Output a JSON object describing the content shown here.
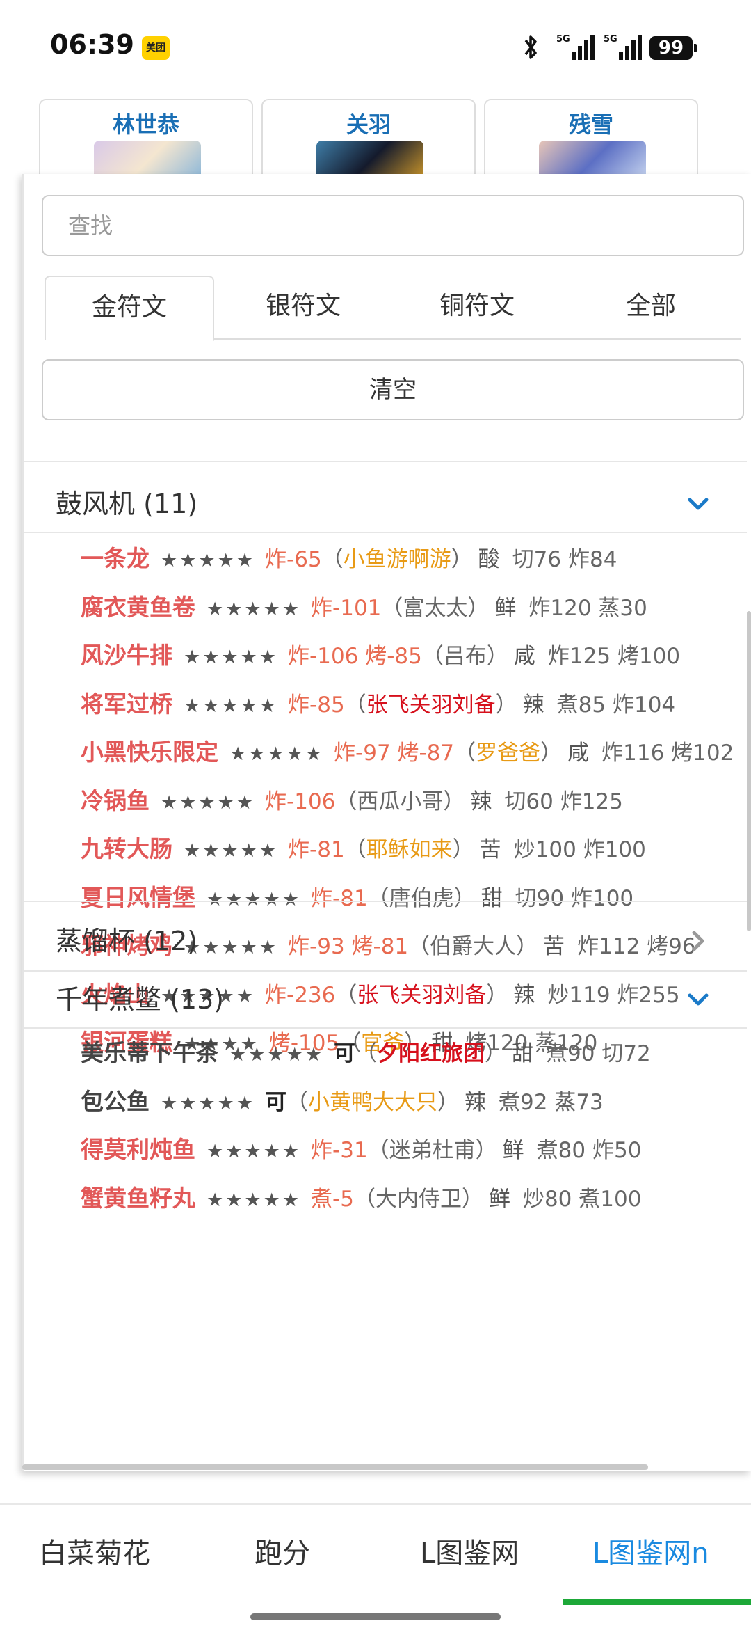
{
  "status_bar": {
    "time": "06:39",
    "app_badge": "美团",
    "battery": "99"
  },
  "cards": [
    {
      "name": "林世恭"
    },
    {
      "name": "关羽"
    },
    {
      "name": "残雪"
    }
  ],
  "search": {
    "placeholder": "查找"
  },
  "tabs": [
    {
      "label": "金符文",
      "active": true
    },
    {
      "label": "银符文",
      "active": false
    },
    {
      "label": "铜符文",
      "active": false
    },
    {
      "label": "全部",
      "active": false
    }
  ],
  "clear_label": "清空",
  "groups": [
    {
      "title": "鼓风机 (11)",
      "expanded": true,
      "dishes": [
        {
          "name": "一条龙",
          "stars": "★★★★★",
          "op": "炸-65",
          "chef": "小鱼游啊游",
          "chef_style": "orange",
          "flavor": "酸",
          "req": "切76 炸84"
        },
        {
          "name": "腐衣黄鱼卷",
          "stars": "★★★★★",
          "op": "炸-101",
          "chef": "富太太",
          "chef_style": "plain",
          "flavor": "鲜",
          "req": "炸120 蒸30"
        },
        {
          "name": "风沙牛排",
          "stars": "★★★★★",
          "op": "炸-106 烤-85",
          "chef": "吕布",
          "chef_style": "plain",
          "flavor": "咸",
          "req": "炸125 烤100"
        },
        {
          "name": "将军过桥",
          "stars": "★★★★★",
          "op": "炸-85",
          "chef": "张飞关羽刘备",
          "chef_style": "red",
          "flavor": "辣",
          "req": "煮85 炸104"
        },
        {
          "name": "小黑快乐限定",
          "stars": "★★★★★",
          "op": "炸-97 烤-87",
          "chef": "罗爸爸",
          "chef_style": "orange",
          "flavor": "咸",
          "req": "炸116 烤102"
        },
        {
          "name": "冷锅鱼",
          "stars": "★★★★★",
          "op": "炸-106",
          "chef": "西瓜小哥",
          "chef_style": "plain",
          "flavor": "辣",
          "req": "切60 炸125"
        },
        {
          "name": "九转大肠",
          "stars": "★★★★★",
          "op": "炸-81",
          "chef": "耶稣如来",
          "chef_style": "orange",
          "flavor": "苦",
          "req": "炒100 炸100"
        },
        {
          "name": "夏日风情堡",
          "stars": "★★★★★",
          "op": "炸-81",
          "chef": "唐伯虎",
          "chef_style": "plain",
          "flavor": "甜",
          "req": "切90 炸100"
        },
        {
          "name": "邪神烤鸡",
          "stars": "★★★★★",
          "op": "炸-93 烤-81",
          "chef": "伯爵大人",
          "chef_style": "plain",
          "flavor": "苦",
          "req": "炸112 烤96"
        },
        {
          "name": "火焰山",
          "stars": "★★★★★",
          "op": "炸-236",
          "chef": "张飞关羽刘备",
          "chef_style": "red",
          "flavor": "辣",
          "req": "炒119 炸255"
        },
        {
          "name": "银河蛋糕",
          "stars": "★★★★",
          "op": "烤-105",
          "chef": "官爷",
          "chef_style": "orange",
          "flavor": "甜",
          "req": "烤120 蒸120"
        }
      ]
    },
    {
      "title": "蒸馏杯 (12)",
      "expanded": false
    },
    {
      "title": "千年煮鳖 (13)",
      "expanded": true,
      "dishes": [
        {
          "name": "美乐蒂下午茶",
          "name_style": "dark",
          "stars": "★★★★★",
          "op": "可",
          "op_style": "bold",
          "chef": "夕阳红旅团",
          "chef_style": "redb",
          "flavor": "甜",
          "req": "煮90 切72"
        },
        {
          "name": "包公鱼",
          "name_style": "dark",
          "stars": "★★★★★",
          "op": "可",
          "op_style": "bold",
          "chef": "小黄鸭大大只",
          "chef_style": "orange",
          "flavor": "辣",
          "req": "煮92 蒸73"
        },
        {
          "name": "得莫利炖鱼",
          "stars": "★★★★★",
          "op": "炸-31",
          "chef": "迷弟杜甫",
          "chef_style": "plain",
          "flavor": "鲜",
          "req": "煮80 炸50"
        },
        {
          "name": "蟹黄鱼籽丸",
          "stars": "★★★★★",
          "op": "煮-5",
          "chef": "大内侍卫",
          "chef_style": "plain",
          "flavor": "鲜",
          "req": "炒80 煮100"
        }
      ]
    }
  ],
  "bottom_nav": [
    {
      "label": "白菜菊花"
    },
    {
      "label": "跑分"
    },
    {
      "label": "L图鉴网"
    },
    {
      "label": "L图鉴网n",
      "active": true
    }
  ],
  "colors": {
    "accent_blue": "#1a8ae0",
    "dish_red": "#e25858",
    "op_red": "#e86a50",
    "chef_orange": "#e89a15",
    "chef_red": "#d6101c",
    "nav_underline": "#1da838"
  }
}
